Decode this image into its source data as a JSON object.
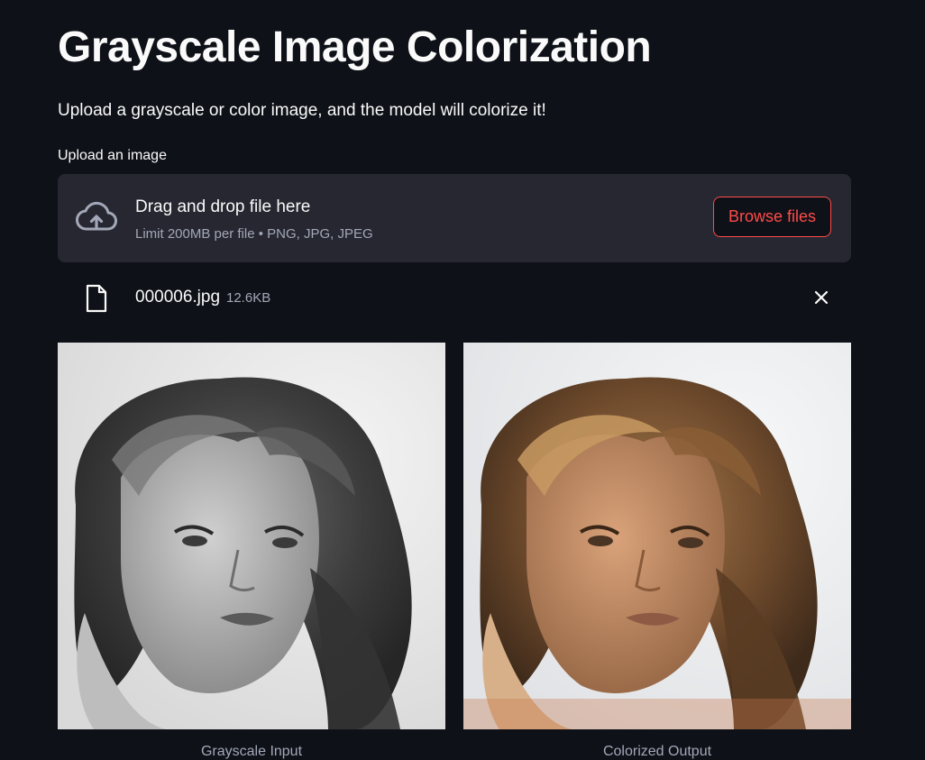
{
  "header": {
    "title": "Grayscale Image Colorization",
    "subtitle": "Upload a grayscale or color image, and the model will colorize it!"
  },
  "uploader": {
    "label": "Upload an image",
    "drop_text": "Drag and drop file here",
    "hint": "Limit 200MB per file • PNG, JPG, JPEG",
    "browse_label": "Browse files",
    "icon": "cloud-upload-icon"
  },
  "uploaded_file": {
    "name": "000006.jpg",
    "size": "12.6KB",
    "icon": "file-icon",
    "remove_icon": "close-icon"
  },
  "images": {
    "input_caption": "Grayscale Input",
    "output_caption": "Colorized Output"
  },
  "colors": {
    "background": "#0e1117",
    "dropzone": "#262730",
    "accent": "#ff4b4b",
    "muted_text": "#a3a8b8"
  }
}
